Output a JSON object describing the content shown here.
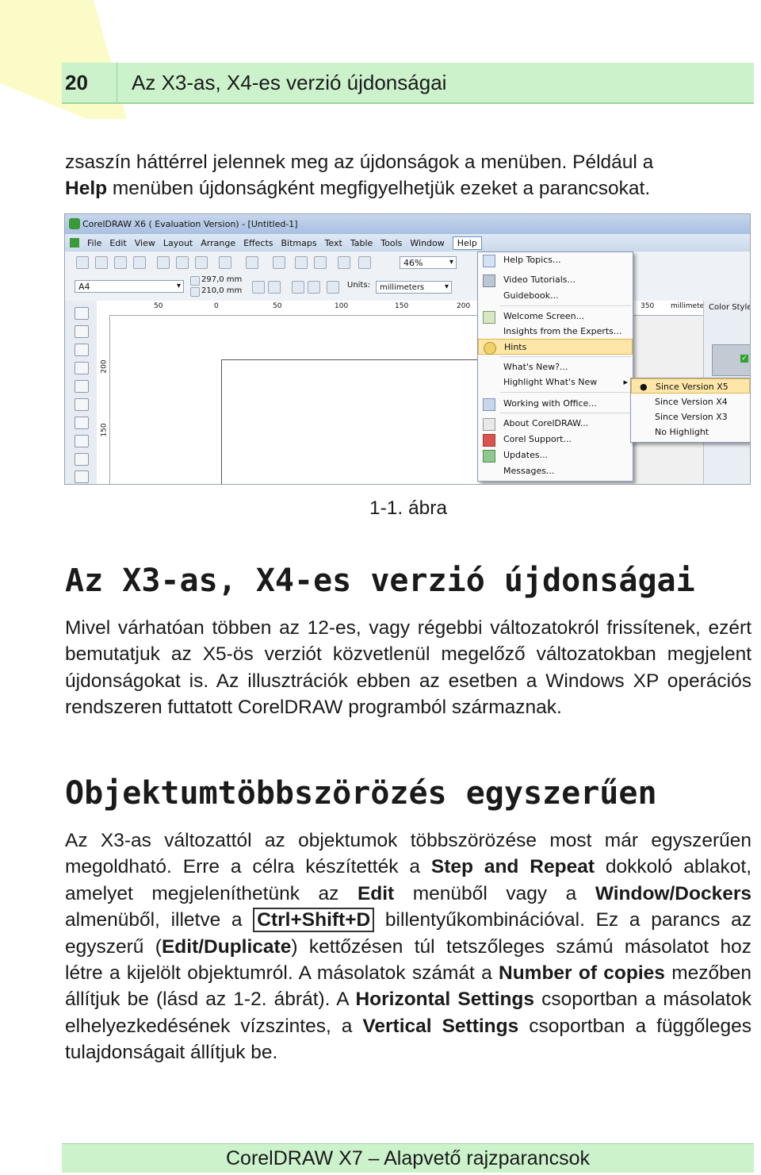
{
  "header": {
    "page_number": "20",
    "title": "Az X3-as, X4-es verzió újdonságai"
  },
  "intro": {
    "line1": "zsaszín háttérrel jelennek meg az újdonságok a menüben. Például a",
    "line2_bold": "Help",
    "line2_rest": " menüben újdonságként megfigyelhetjük ezeket a parancsokat."
  },
  "screenshot": {
    "window_title": "CorelDRAW X6 ( Evaluation Version) - [Untitled-1]",
    "menubar": [
      "File",
      "Edit",
      "View",
      "Layout",
      "Arrange",
      "Effects",
      "Bitmaps",
      "Text",
      "Table",
      "Tools",
      "Window",
      "Help"
    ],
    "zoom": "46%",
    "paper_size": "A4",
    "width": "297,0 mm",
    "height": "210,0 mm",
    "units_label": "Units:",
    "units_value": "millimeters",
    "ruler_h": [
      "50",
      "0",
      "50",
      "100",
      "150",
      "200",
      "350"
    ],
    "ruler_h_units": "millimeters",
    "ruler_v": [
      "200",
      "150"
    ],
    "docker_title": "Color Styles",
    "help_menu": [
      "Help Topics...",
      "Video Tutorials...",
      "Guidebook...",
      "Welcome Screen...",
      "Insights from the Experts...",
      "Hints",
      "What's New?...",
      "Highlight What's New",
      "Working with Office...",
      "About CorelDRAW...",
      "Corel Support...",
      "Updates...",
      "Messages..."
    ],
    "submenu": [
      "Since Version X5",
      "Since Version X4",
      "Since Version X3",
      "No Highlight"
    ]
  },
  "caption": "1-1. ábra",
  "section1": {
    "heading": "Az X3-as, X4-es verzió újdonságai",
    "body": "Mivel várhatóan többen az 12-es, vagy régebbi változatokról frissítenek, ezért bemutatjuk az X5-ös verziót közvetlenül megelőző változatokban megjelent újdonságokat is. Az illusztrációk ebben az esetben a Windows XP operációs rendszeren futtatott CorelDRAW programból származnak."
  },
  "section2": {
    "heading": "Objektumtöbbszörözés egyszerűen",
    "t1": "Az X3-as változattól az objektumok többszörözése most már egyszerűen megoldható. Erre a célra készítették a ",
    "b1": "Step and Repeat",
    "t2": " dokkoló ablakot, amelyet megjeleníthetünk az ",
    "b2": "Edit",
    "t3": " menüből vagy a ",
    "b3": "Window/Dockers",
    "t4": " almenüből, illetve a ",
    "kbd": "Ctrl+Shift+D",
    "t5": " billentyűkombinációval. Ez a parancs az egyszerű (",
    "b4": "Edit/Duplicate",
    "t6": ") kettőzésen túl tetszőleges számú másolatot hoz létre a kijelölt objektumról. A másolatok számát a ",
    "b5": "Number of copies",
    "t7": " mezőben állítjuk be (lásd az 1-2. ábrát). A ",
    "b6": "Horizontal Settings",
    "t8": " csoportban a másolatok elhelyezkedésének vízszintes, a ",
    "b7": "Vertical Settings",
    "t9": " csoportban a függőleges tulajdonságait állítjuk be."
  },
  "footer": "CorelDRAW X7 – Alapvető rajzparancsok"
}
